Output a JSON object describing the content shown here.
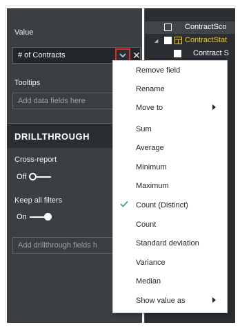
{
  "visualizations_pane": {
    "value_label": "Value",
    "value_field": "# of Contracts",
    "tooltips_label": "Tooltips",
    "tooltips_placeholder": "Add data fields here",
    "drillthrough_header": "DRILLTHROUGH",
    "cross_report_label": "Cross-report",
    "cross_report_state": "Off",
    "keep_all_filters_label": "Keep all filters",
    "keep_all_filters_state": "On",
    "drillthrough_placeholder": "Add drillthrough fields h"
  },
  "fields_pane": {
    "rows": [
      {
        "label": "ContractSco",
        "color": "#ffffff"
      },
      {
        "label": "ContractStat",
        "color": "#f2c811"
      },
      {
        "label": "Contract S",
        "color": "#ffffff"
      }
    ],
    "accent_color": "#f2c811"
  },
  "context_menu": {
    "items": [
      {
        "label": "Remove field",
        "has_submenu": false,
        "checked": false
      },
      {
        "label": "Rename",
        "has_submenu": false,
        "checked": false
      },
      {
        "label": "Move to",
        "has_submenu": true,
        "checked": false
      },
      {
        "label": "Sum",
        "has_submenu": false,
        "checked": false
      },
      {
        "label": "Average",
        "has_submenu": false,
        "checked": false
      },
      {
        "label": "Minimum",
        "has_submenu": false,
        "checked": false
      },
      {
        "label": "Maximum",
        "has_submenu": false,
        "checked": false
      },
      {
        "label": "Count (Distinct)",
        "has_submenu": false,
        "checked": true
      },
      {
        "label": "Count",
        "has_submenu": false,
        "checked": false
      },
      {
        "label": "Standard deviation",
        "has_submenu": false,
        "checked": false
      },
      {
        "label": "Variance",
        "has_submenu": false,
        "checked": false
      },
      {
        "label": "Median",
        "has_submenu": false,
        "checked": false
      },
      {
        "label": "Show value as",
        "has_submenu": true,
        "checked": false
      }
    ],
    "check_color": "#3aa981"
  },
  "highlight_color": "#e32a2a"
}
